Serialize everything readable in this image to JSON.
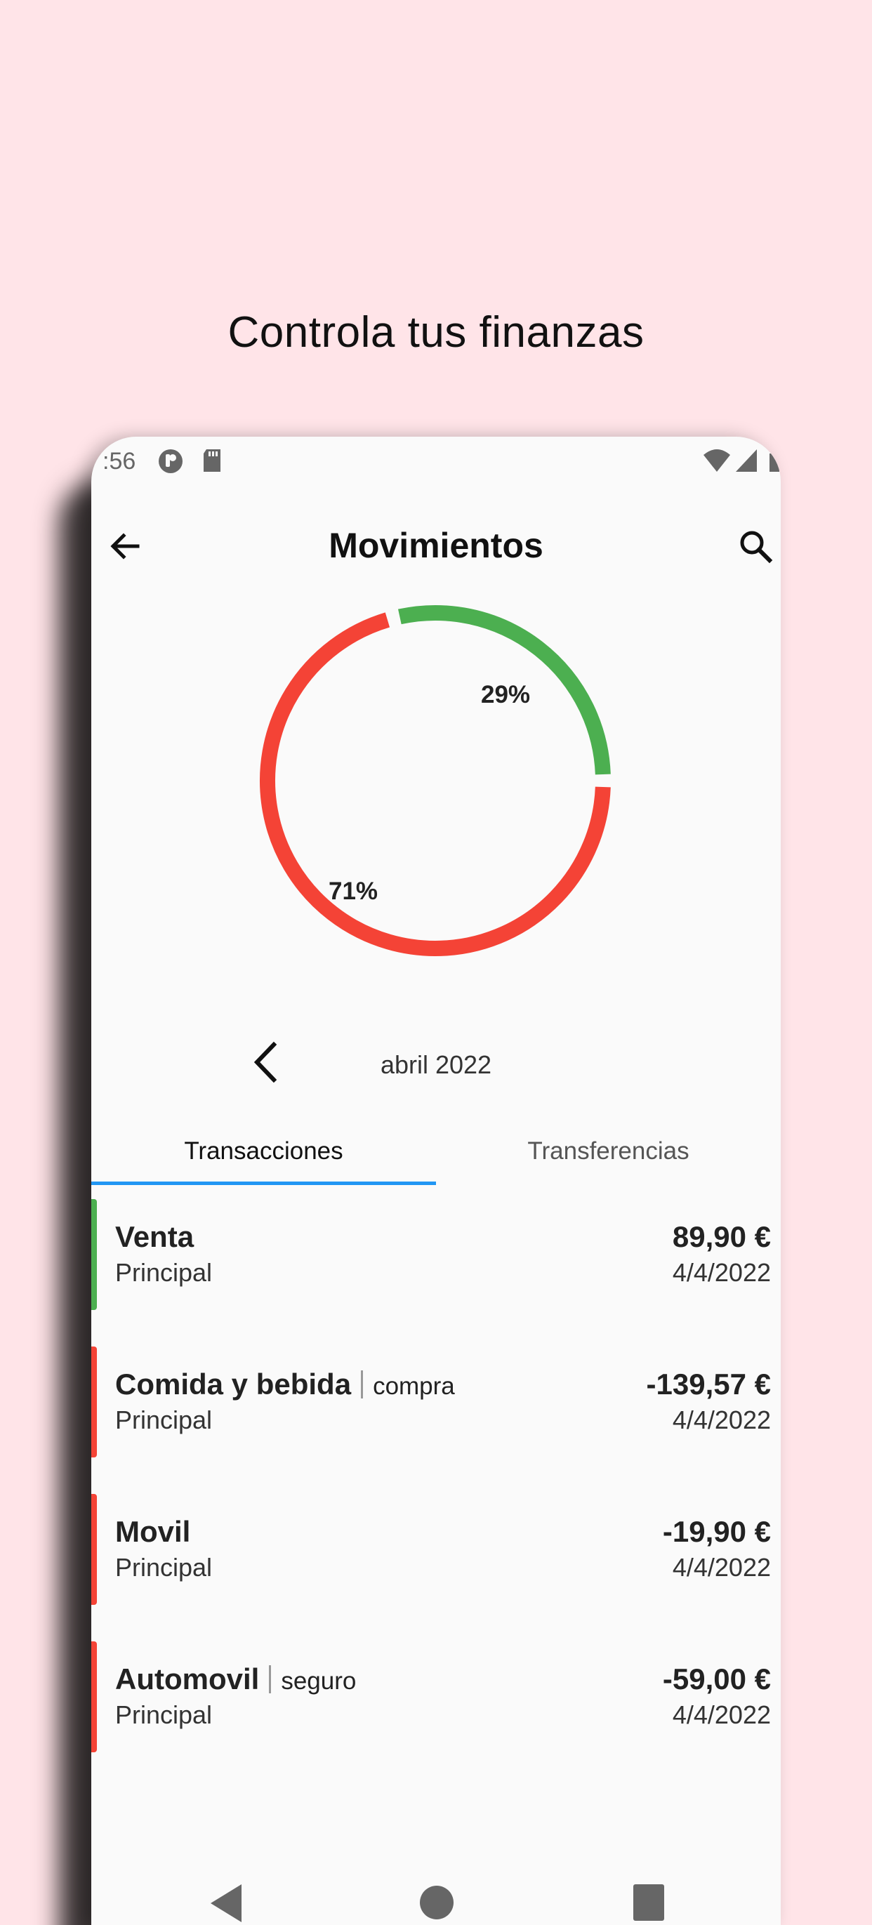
{
  "promo": {
    "headline": "Controla tus finanzas"
  },
  "status_bar": {
    "time": ":56"
  },
  "app_bar": {
    "title": "Movimientos",
    "back_icon": "arrow-left-icon",
    "search_icon": "search-icon"
  },
  "summary": {
    "income_label": "29%",
    "expense_label": "71%",
    "income_color": "#4caf50",
    "expense_color": "#f44336",
    "income_fraction": 0.29,
    "expense_fraction": 0.71
  },
  "period": {
    "label": "abril 2022",
    "prev_icon": "chevron-left-icon"
  },
  "tabs": [
    {
      "label": "Transacciones",
      "selected": true
    },
    {
      "label": "Transferencias",
      "selected": false
    }
  ],
  "accent_color": "#2196f3",
  "transactions": [
    {
      "category": "Venta",
      "subcategory": "",
      "account": "Principal",
      "amount": "89,90 €",
      "date": "4/4/2022",
      "type": "income",
      "color": "#4caf50"
    },
    {
      "category": "Comida y bebida",
      "subcategory": "compra",
      "account": "Principal",
      "amount": "-139,57 €",
      "date": "4/4/2022",
      "type": "expense",
      "color": "#f44336"
    },
    {
      "category": "Movil",
      "subcategory": "",
      "account": "Principal",
      "amount": "-19,90 €",
      "date": "4/4/2022",
      "type": "expense",
      "color": "#f44336"
    },
    {
      "category": "Automovil",
      "subcategory": "seguro",
      "account": "Principal",
      "amount": "-59,00 €",
      "date": "4/4/2022",
      "type": "expense",
      "color": "#f44336"
    }
  ]
}
